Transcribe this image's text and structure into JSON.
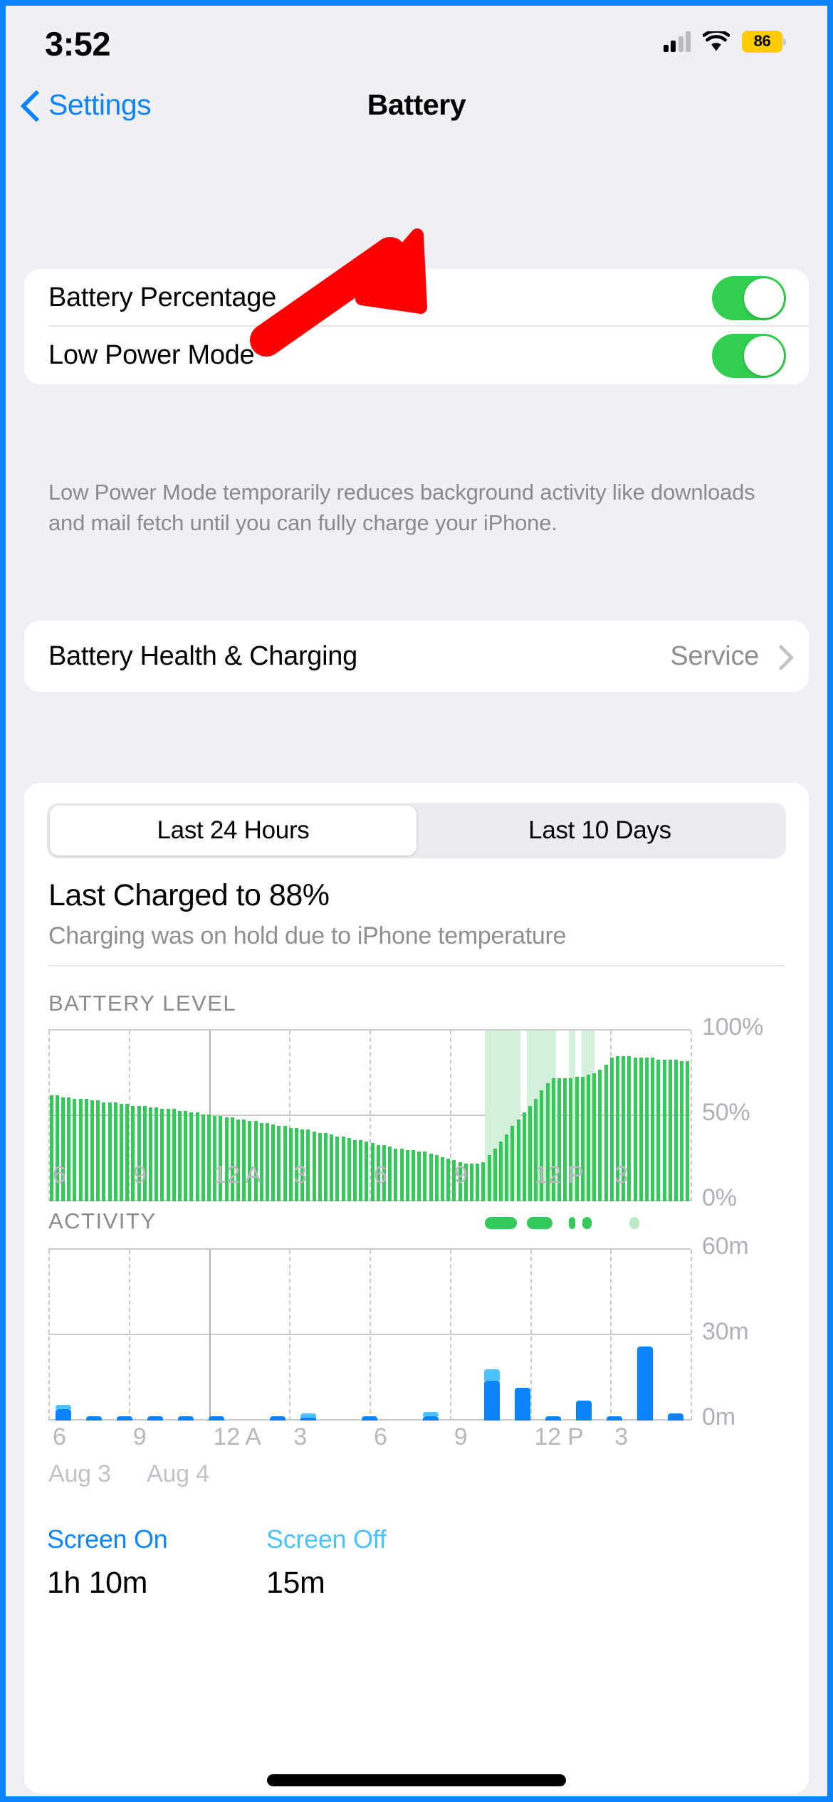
{
  "status_bar": {
    "time": "3:52",
    "signal_icon": "cellular-signal-icon",
    "wifi_icon": "wifi-icon",
    "battery_percent": "86",
    "battery_icon": "battery-low-power-icon",
    "battery_color": "#ffcc00"
  },
  "nav": {
    "back_label": "Settings",
    "back_icon": "chevron-left-icon",
    "title": "Battery"
  },
  "toggles_card": {
    "rows": [
      {
        "label": "Battery Percentage",
        "state": "on"
      },
      {
        "label": "Low Power Mode",
        "state": "on"
      }
    ],
    "toggle_on_color": "#30cf4f"
  },
  "low_power_note": "Low Power Mode temporarily reduces background activity like downloads and mail fetch until you can fully charge your iPhone.",
  "health_card": {
    "label": "Battery Health & Charging",
    "value": "Service",
    "chevron_icon": "chevron-right-icon"
  },
  "usage_card": {
    "segments": [
      {
        "label": "Last 24 Hours",
        "selected": true
      },
      {
        "label": "Last 10 Days",
        "selected": false
      }
    ],
    "last_charged_title": "Last Charged to 88%",
    "last_charged_subtitle": "Charging was on hold due to iPhone temperature",
    "battery_level_label": "BATTERY LEVEL",
    "activity_label": "ACTIVITY",
    "date_labels": [
      "Aug 3",
      "Aug 4"
    ],
    "legend": {
      "screen_on_label": "Screen On",
      "screen_on_value": "1h 10m",
      "screen_off_label": "Screen Off",
      "screen_off_value": "15m",
      "screen_on_color": "#0a84ff",
      "screen_off_color": "#4cc2ff"
    }
  },
  "annotation": {
    "arrow_color": "#fe0000",
    "points_to": "low-power-mode-toggle"
  },
  "chart_data": [
    {
      "type": "bar",
      "title": "BATTERY LEVEL",
      "xlabel": "",
      "ylabel": "",
      "ylim": [
        0,
        100
      ],
      "yticks": [
        "0%",
        "50%",
        "100%"
      ],
      "xticks": [
        "6",
        "9",
        "12 A",
        "3",
        "6",
        "9",
        "12 P",
        "3"
      ],
      "grid": true,
      "series_color": "#34c759",
      "charging_band_color": "#d3f0d8",
      "values": [
        62,
        62,
        61,
        61,
        60,
        60,
        60,
        59,
        59,
        58,
        58,
        58,
        57,
        57,
        56,
        56,
        56,
        55,
        55,
        54,
        54,
        54,
        53,
        53,
        52,
        52,
        51,
        51,
        50,
        50,
        49,
        49,
        48,
        48,
        47,
        47,
        46,
        46,
        45,
        44,
        44,
        43,
        43,
        42,
        42,
        41,
        40,
        40,
        39,
        38,
        38,
        37,
        36,
        36,
        35,
        34,
        33,
        33,
        32,
        31,
        31,
        30,
        30,
        29,
        29,
        28,
        27,
        26,
        25,
        24,
        23,
        22,
        22,
        22,
        23,
        27,
        31,
        35,
        39,
        44,
        48,
        52,
        56,
        60,
        65,
        69,
        72,
        72,
        72,
        72,
        73,
        73,
        74,
        75,
        77,
        80,
        84,
        85,
        85,
        85,
        84,
        84,
        84,
        84,
        83,
        83,
        83,
        83,
        82,
        82
      ],
      "charging_bands": [
        {
          "start_pct": 68.0,
          "end_pct": 73.5
        },
        {
          "start_pct": 74.5,
          "end_pct": 79.0
        },
        {
          "start_pct": 81.0,
          "end_pct": 82.0
        },
        {
          "start_pct": 83.0,
          "end_pct": 85.0
        }
      ],
      "charging_pills": [
        {
          "start_pct": 68.0,
          "end_pct": 73.0,
          "opacity": 1
        },
        {
          "start_pct": 74.5,
          "end_pct": 78.5,
          "opacity": 1
        },
        {
          "start_pct": 81.0,
          "end_pct": 82.0,
          "opacity": 1
        },
        {
          "start_pct": 83.2,
          "end_pct": 84.6,
          "opacity": 1
        },
        {
          "start_pct": 90.5,
          "end_pct": 92.0,
          "opacity": 0.35
        }
      ]
    },
    {
      "type": "bar",
      "title": "ACTIVITY",
      "xlabel": "",
      "ylabel": "",
      "ylim": [
        0,
        60
      ],
      "yticks": [
        "0m",
        "30m",
        "60m"
      ],
      "xticks": [
        "6",
        "9",
        "12 A",
        "3",
        "6",
        "9",
        "12 P",
        "3"
      ],
      "grid": true,
      "unit": "m",
      "series": [
        {
          "name": "Screen On",
          "color": "#0a84ff",
          "values": [
            4.0,
            1.0,
            1.6,
            1.0,
            1.0,
            1.0,
            0.0,
            1.0,
            1.0,
            0.0,
            1.0,
            0.0,
            1.4,
            0.0,
            14.0,
            11.5,
            1.6,
            7.0,
            1.4,
            26.0,
            2.4
          ]
        },
        {
          "name": "Screen Off",
          "color": "#4cc2ff",
          "values": [
            0.7,
            0.0,
            0.0,
            0.0,
            0.0,
            0.0,
            0.0,
            0.0,
            1.0,
            0.0,
            0.0,
            0.0,
            0.6,
            0.0,
            4.0,
            0.0,
            0.0,
            0.0,
            0.0,
            0.0,
            0.0
          ]
        }
      ]
    }
  ]
}
